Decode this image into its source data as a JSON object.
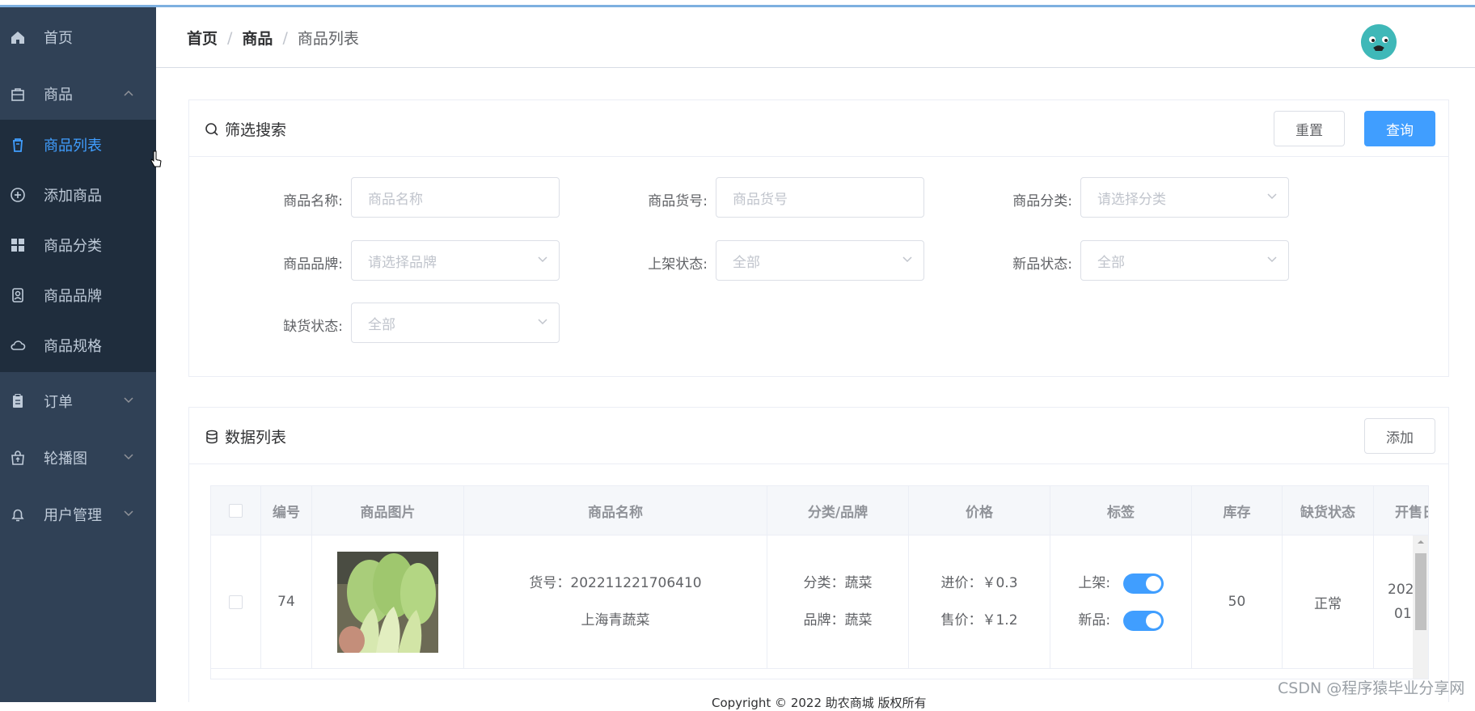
{
  "sidebar": {
    "items": [
      {
        "label": "首页",
        "icon": "home-icon"
      },
      {
        "label": "商品",
        "icon": "bag-icon",
        "expanded": true
      },
      {
        "label": "订单",
        "icon": "clipboard-icon"
      },
      {
        "label": "轮播图",
        "icon": "shopping-bag-icon"
      },
      {
        "label": "用户管理",
        "icon": "bell-icon"
      }
    ],
    "submenu": [
      {
        "label": "商品列表",
        "icon": "trash-list-icon",
        "active": true
      },
      {
        "label": "添加商品",
        "icon": "plus-circle-icon"
      },
      {
        "label": "商品分类",
        "icon": "grid-icon"
      },
      {
        "label": "商品品牌",
        "icon": "brand-icon"
      },
      {
        "label": "商品规格",
        "icon": "cloud-icon"
      }
    ]
  },
  "breadcrumb": [
    "首页",
    "商品",
    "商品列表"
  ],
  "filter": {
    "title": "筛选搜索",
    "reset_label": "重置",
    "query_label": "查询",
    "fields": [
      {
        "label": "商品名称:",
        "placeholder": "商品名称"
      },
      {
        "label": "商品货号:",
        "placeholder": "商品货号"
      },
      {
        "label": "商品分类:",
        "placeholder": "请选择分类"
      },
      {
        "label": "商品品牌:",
        "placeholder": "请选择品牌"
      },
      {
        "label": "上架状态:",
        "placeholder": "全部"
      },
      {
        "label": "新品状态:",
        "placeholder": "全部"
      },
      {
        "label": "缺货状态:",
        "placeholder": "全部"
      }
    ]
  },
  "list": {
    "title": "数据列表",
    "add_label": "添加",
    "columns": [
      "编号",
      "商品图片",
      "商品名称",
      "分类/品牌",
      "价格",
      "标签",
      "库存",
      "缺货状态",
      "开售日"
    ],
    "rows": [
      {
        "id": "74",
        "sku": "货号：202211221706410",
        "name": "上海青蔬菜",
        "category": "分类：蔬菜",
        "brand": "品牌：蔬菜",
        "cost": "进价：￥0.3",
        "price": "售价：￥1.2",
        "tag_on_shelf": "上架:",
        "tag_new": "新品:",
        "stock": "50",
        "stock_status": "正常",
        "sale_date_1": "202",
        "sale_date_2": "01"
      }
    ]
  },
  "footer": "Copyright © 2022 助农商城 版权所有",
  "watermark": "CSDN @程序猿毕业分享网",
  "colors": {
    "sidebar": "#304156",
    "submenu": "#1f2d3d",
    "accent": "#409eff"
  }
}
